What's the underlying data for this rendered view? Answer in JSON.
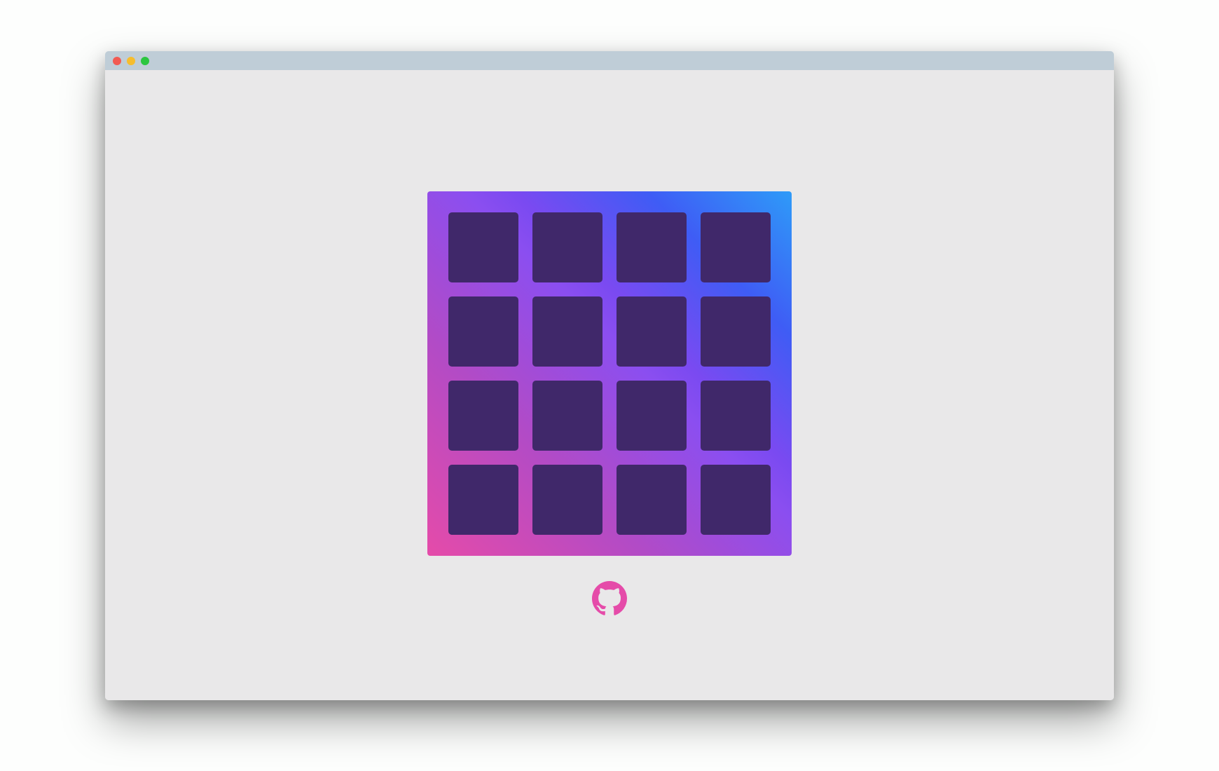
{
  "window": {
    "controls": [
      "close",
      "minimize",
      "maximize"
    ]
  },
  "board": {
    "rows": 4,
    "columns": 4,
    "cells": [
      "",
      "",
      "",
      "",
      "",
      "",
      "",
      "",
      "",
      "",
      "",
      "",
      "",
      "",
      "",
      ""
    ]
  },
  "footer": {
    "icon": "github-icon",
    "icon_color": "#e54ba9"
  },
  "colors": {
    "background": "#e9e8e9",
    "titlebar": "#bfcdd7",
    "cell": "#40286a",
    "gradient_start": "#e54ba9",
    "gradient_mid": "#8b4ef0",
    "gradient_end": "#2e9bf8"
  }
}
